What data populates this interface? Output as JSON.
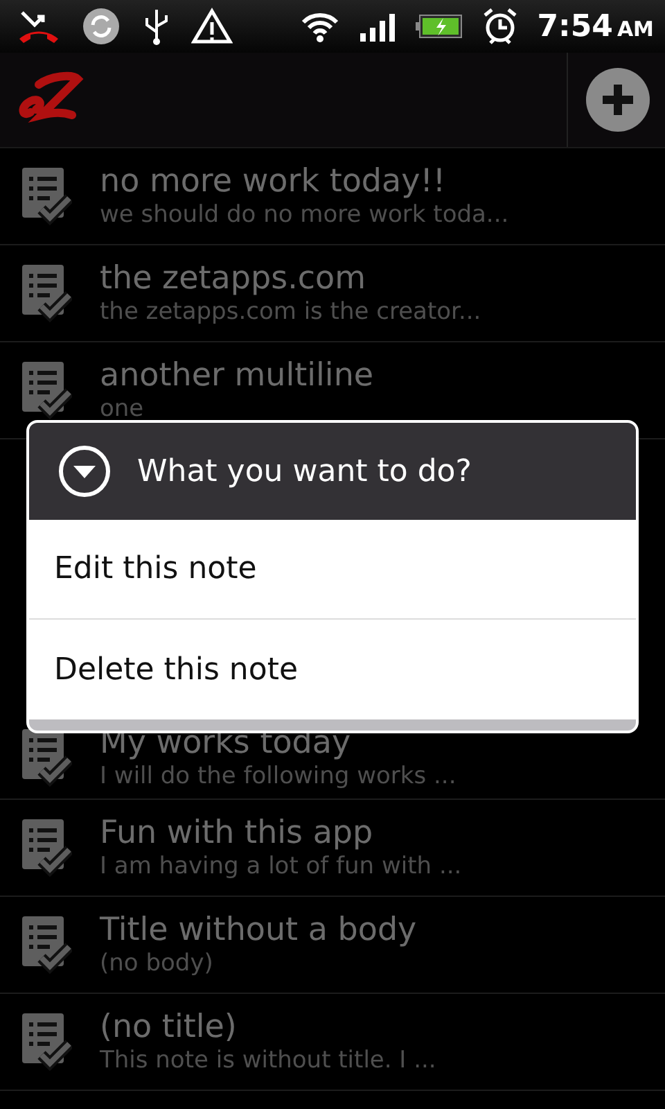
{
  "status_bar": {
    "time": "7:54",
    "ampm": "AM"
  },
  "notes": [
    {
      "title": "no more work today!!",
      "preview": "we should do no more work toda..."
    },
    {
      "title": "the zetapps.com",
      "preview": "the zetapps.com is the creator..."
    },
    {
      "title": "another multiline",
      "preview": "one"
    },
    {
      "title": "My works today",
      "preview": "I will do the following works ..."
    },
    {
      "title": "Fun with this app",
      "preview": "I am having a lot of fun with ..."
    },
    {
      "title": "Title without a body",
      "preview": "(no body)"
    },
    {
      "title": "(no title)",
      "preview": "This note is without title. I ..."
    }
  ],
  "dialog": {
    "title": "What you want to do?",
    "options": [
      "Edit this note",
      "Delete this note"
    ]
  }
}
